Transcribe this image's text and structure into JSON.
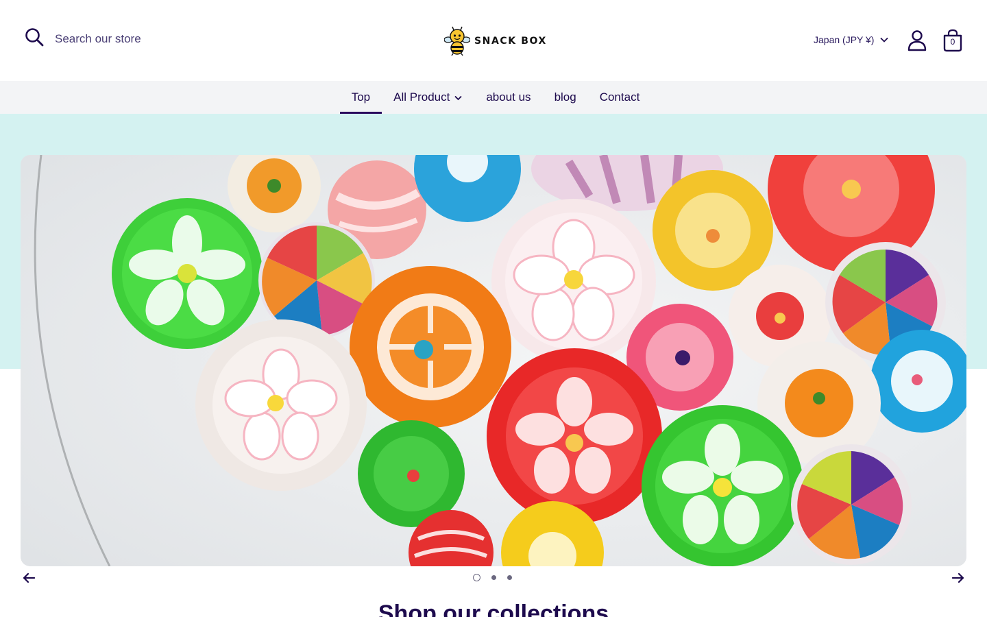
{
  "header": {
    "search_placeholder": "Search our store",
    "search_icon": "search-icon",
    "logo_text": "SNACK BOX",
    "currency": "Japan (JPY ¥)",
    "cart_count": "0",
    "account_icon": "account-icon",
    "cart_icon": "cart-bag-icon"
  },
  "nav": {
    "items": [
      {
        "label": "Top",
        "active": true
      },
      {
        "label": "All Product",
        "dropdown": true
      },
      {
        "label": "about us"
      },
      {
        "label": "blog"
      },
      {
        "label": "Contact"
      }
    ]
  },
  "hero": {
    "slide_image": "colorful-hard-candies-in-glass-bowl",
    "slide_count": 3,
    "current_slide": 1,
    "prev_icon": "arrow-left-icon",
    "next_icon": "arrow-right-icon"
  },
  "collections": {
    "title": "Shop our collections"
  },
  "colors": {
    "primary": "#1d0a4d",
    "hero_bg": "#d4f2f1",
    "nav_bg": "#f3f4f6"
  }
}
